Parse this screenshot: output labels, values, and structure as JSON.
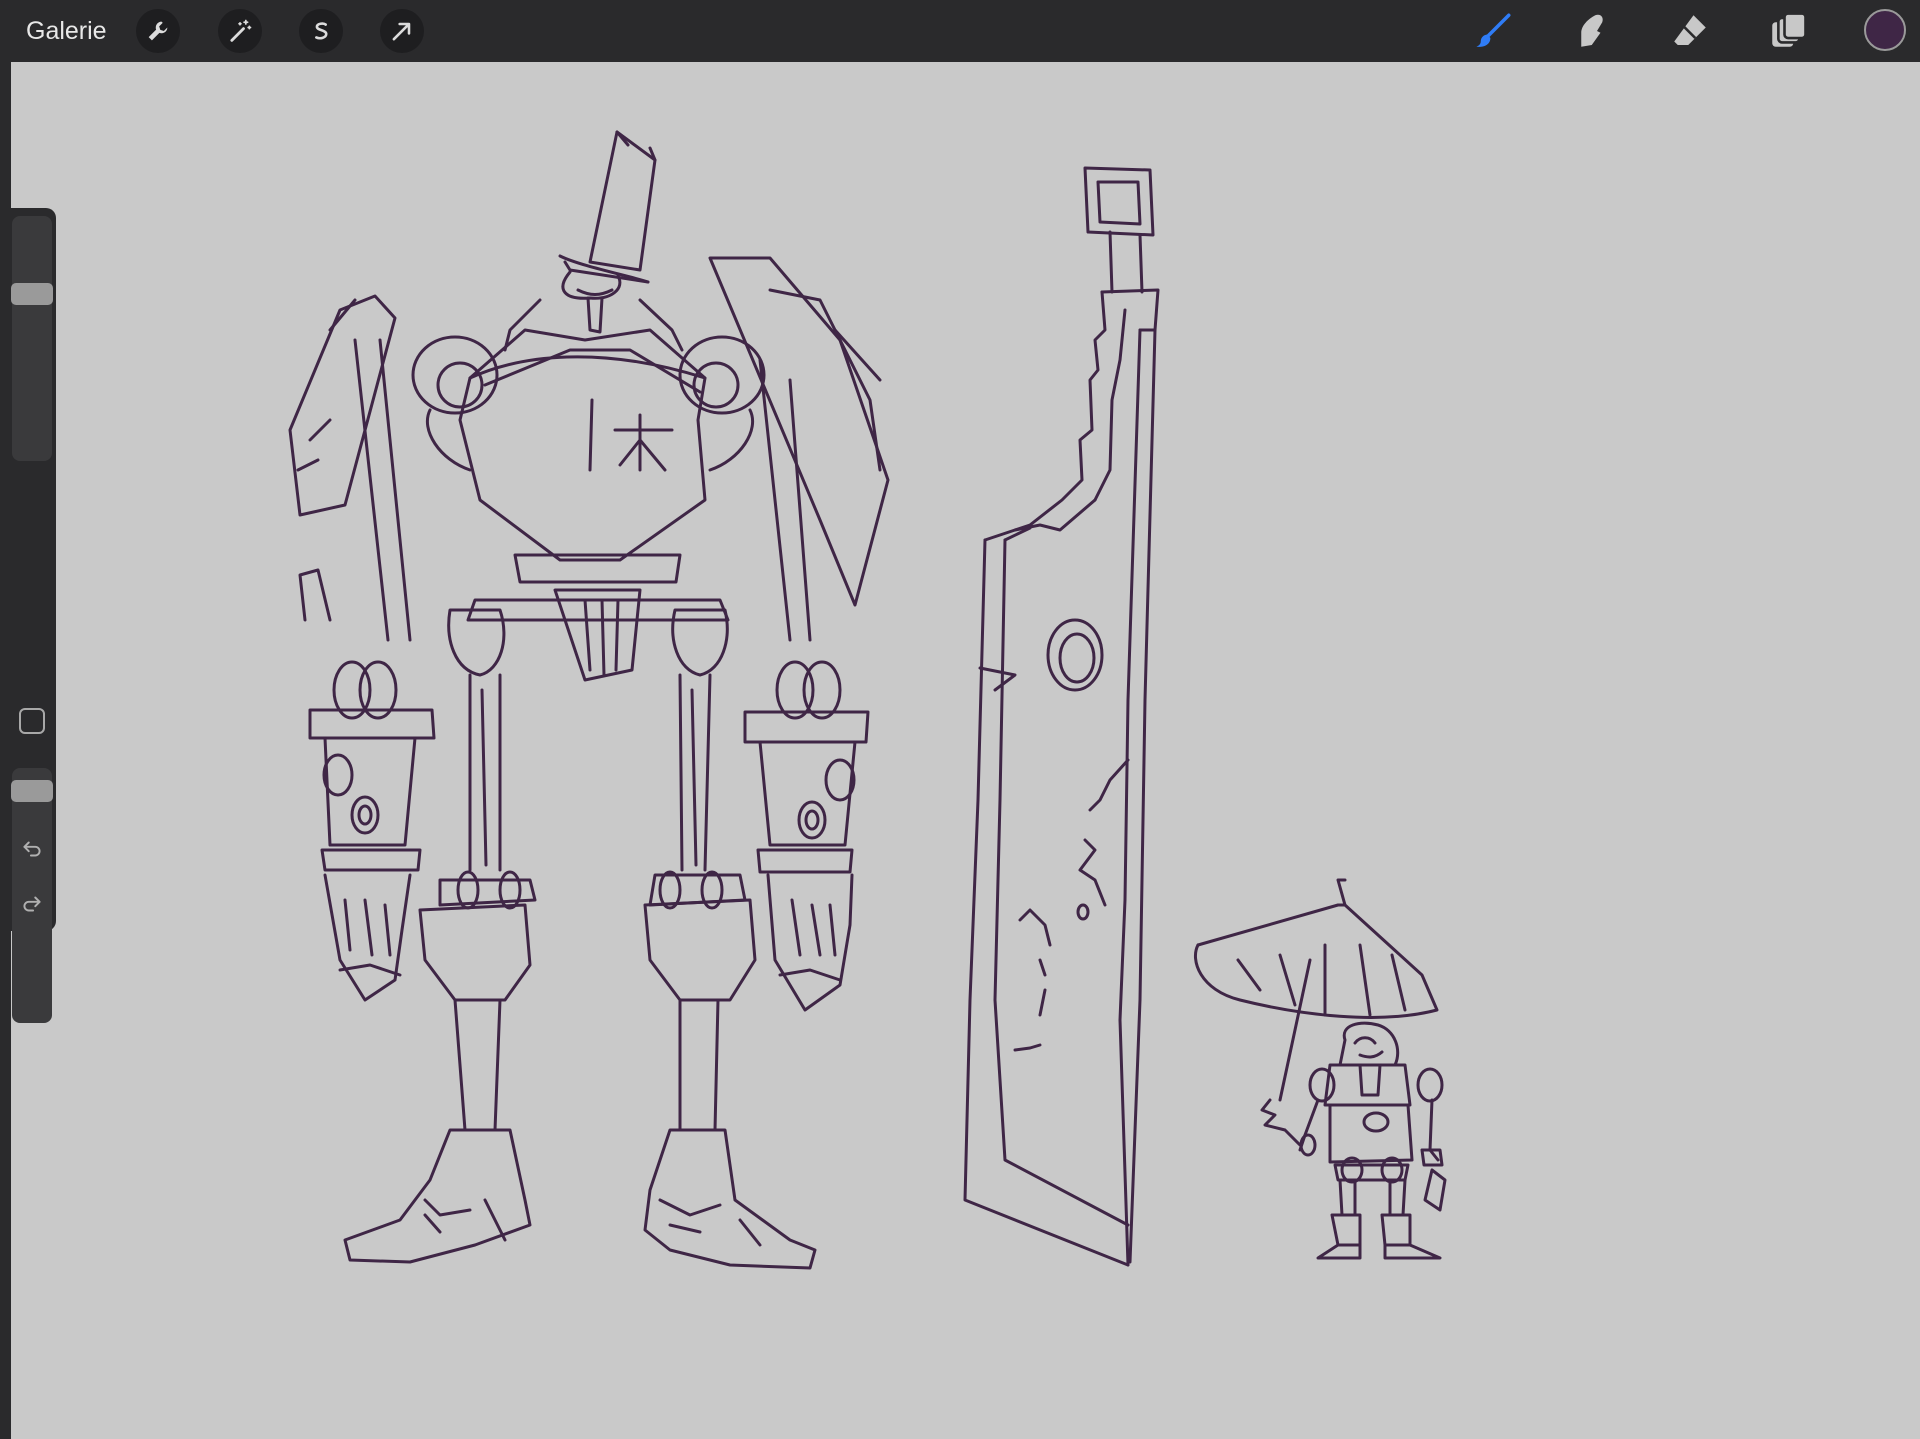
{
  "app": {
    "gallery_label": "Galerie"
  },
  "toolbar_left": [
    {
      "name": "actions-button",
      "icon": "wrench-icon"
    },
    {
      "name": "adjustments-button",
      "icon": "magic-wand-icon"
    },
    {
      "name": "selection-button",
      "icon": "selection-s-icon"
    },
    {
      "name": "transform-button",
      "icon": "arrow-cursor-icon"
    }
  ],
  "toolbar_right": [
    {
      "name": "brush-tool",
      "icon": "brush-icon",
      "active": true
    },
    {
      "name": "smudge-tool",
      "icon": "smudge-finger-icon",
      "active": false
    },
    {
      "name": "eraser-tool",
      "icon": "eraser-icon",
      "active": false
    },
    {
      "name": "layers-button",
      "icon": "layers-icon",
      "active": false
    }
  ],
  "current_color": "#3f2646",
  "colors": {
    "accent_active": "#2f7cf6",
    "toolbar_bg": "#2a2a2c",
    "canvas_bg": "#c9c9c9",
    "ink": "#3f2646",
    "icon_inactive": "#c8c8c8"
  },
  "sidebar": {
    "brush_size_level": 0.7,
    "opacity_level": 0.95,
    "undo_icon": "undo-icon",
    "redo_icon": "redo-icon",
    "modify_icon": "square-modify-icon"
  }
}
